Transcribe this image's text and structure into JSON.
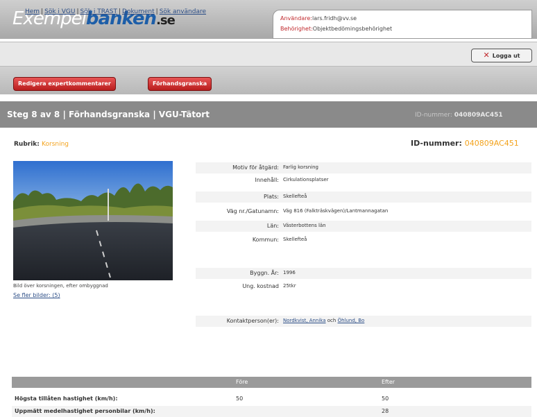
{
  "header": {
    "logo_part1": "Exempel",
    "logo_part2": "banken",
    "logo_part3": ".se",
    "user_label": "Användare:",
    "user_value": "lars.fridh@vv.se",
    "auth_label": "Behörighet:",
    "auth_value": "Objektbedömingsbehörighet"
  },
  "nav": {
    "links": [
      "Hem",
      "Sök i VGU",
      "Sök i TRAST",
      "Dokument",
      "Sök användare"
    ],
    "logout_label": "Logga ut"
  },
  "actions": {
    "edit_comments": "Redigera expertkommentarer",
    "preview": "Förhandsgranska"
  },
  "step": {
    "title": "Steg 8 av 8 | Förhandsgranska | VGU-Tätort",
    "id_label": "ID-nummer:",
    "id_value": "040809AC451"
  },
  "record": {
    "rubrik_label": "Rubrik:",
    "rubrik_value": "Korsning",
    "id_label": "ID-nummer:",
    "id_value": "040809AC451",
    "photo_caption": "Bild över korsningen, efter ombyggnad",
    "more_pictures": "Se fler bilder: (5)",
    "details": [
      {
        "key": "Motiv för åtgärd:",
        "value": "Farlig korsning"
      },
      {
        "key": "Innehåll:",
        "value": "Cirkulationsplatser"
      },
      {
        "key": "Plats:",
        "value": "Skellefteå"
      },
      {
        "key": "Väg nr./Gatunamn:",
        "value": "Väg 816 (Falkträskvägen)/Lantmannagatan"
      },
      {
        "key": "Län:",
        "value": "Västerbottens län"
      },
      {
        "key": "Kommun:",
        "value": "Skellefteå"
      },
      {
        "key": "Byggn. År:",
        "value": "1996"
      },
      {
        "key": "Ung. kostnad",
        "value": "25tkr"
      }
    ],
    "contact_label": "Kontaktperson(er):",
    "contact_person1": "Nordkvist, Annika",
    "contact_and": "och",
    "contact_person2": "Öhlund, Bo"
  },
  "table": {
    "headers": [
      "",
      "Före",
      "Efter"
    ],
    "rows": [
      {
        "label": "Högsta tillåten hastighet (km/h):",
        "before": "50",
        "after": "50"
      },
      {
        "label": "Uppmätt medelhastighet personbilar (km/h):",
        "before": "",
        "after": "28"
      }
    ]
  },
  "colors": {
    "brand_blue": "#1d5ea8",
    "accent_orange": "#f3a21b",
    "action_red": "#c0282c"
  }
}
